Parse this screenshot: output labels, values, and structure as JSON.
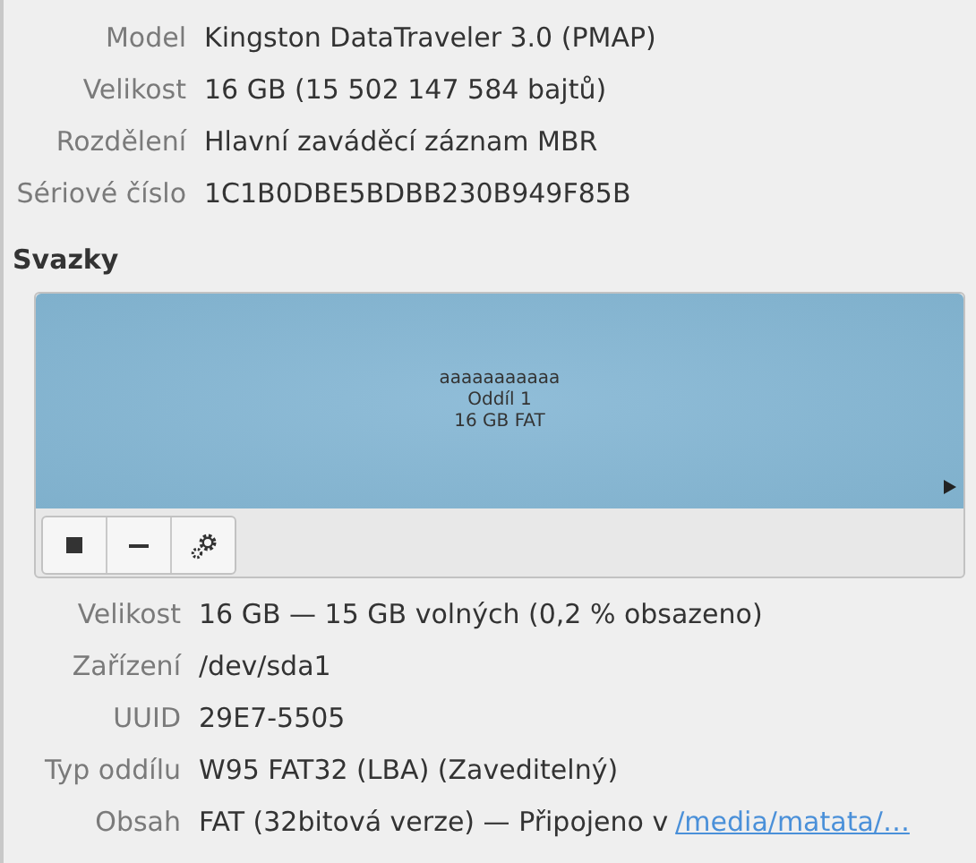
{
  "drive": [
    {
      "label": "Model",
      "value": "Kingston DataTraveler 3.0 (PMAP)"
    },
    {
      "label": "Velikost",
      "value": "16 GB (15 502 147 584 bajtů)"
    },
    {
      "label": "Rozdělení",
      "value": "Hlavní zaváděcí záznam MBR"
    },
    {
      "label": "Sériové číslo",
      "value": "1C1B0DBE5BDBB230B949F85B"
    }
  ],
  "volumes": {
    "heading": "Svazky",
    "partition": {
      "selected": true,
      "lines": [
        "aaaaaaaaaaa",
        "Oddíl 1",
        "16 GB FAT"
      ]
    },
    "details": [
      {
        "label": "Velikost",
        "value": "16 GB — 15 GB volných (0,2 % obsazeno)"
      },
      {
        "label": "Zařízení",
        "value": "/dev/sda1"
      },
      {
        "label": "UUID",
        "value": "29E7-5505"
      },
      {
        "label": "Typ oddílu",
        "value": "W95 FAT32 (LBA) (Zaveditelný)"
      },
      {
        "label": "Obsah",
        "value": "FAT (32bitová verze) — Připojeno v",
        "link": "/media/matata/…"
      }
    ]
  }
}
